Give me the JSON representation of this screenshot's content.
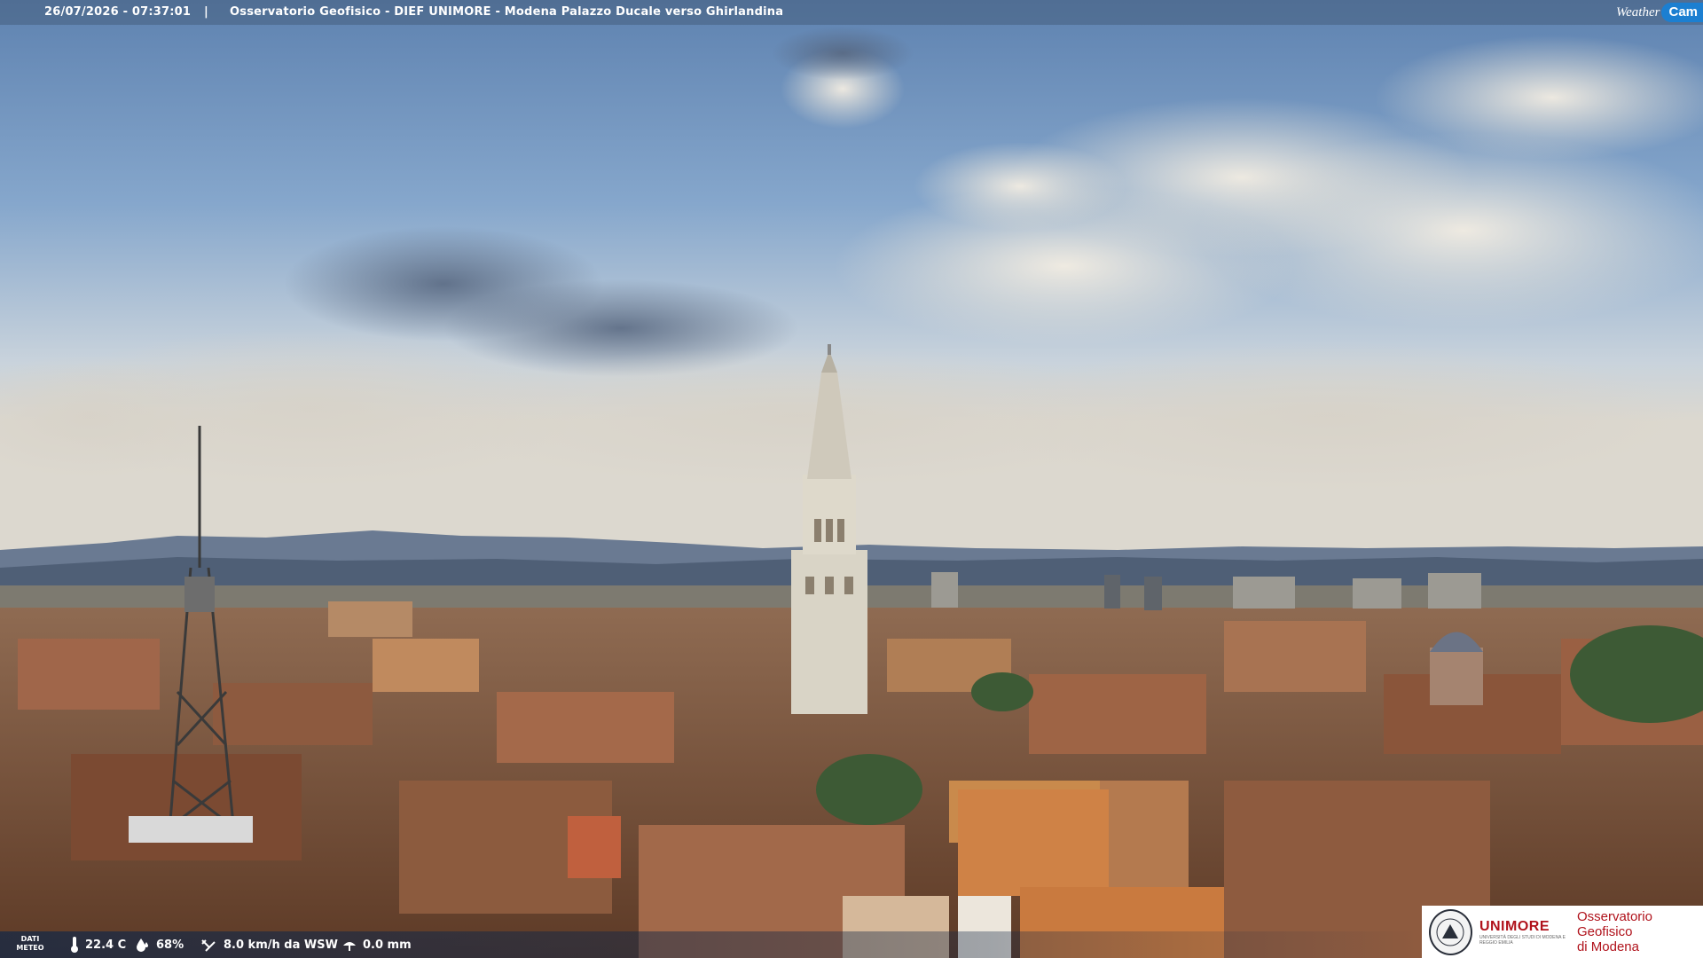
{
  "header": {
    "timestamp": "26/07/2026 - 07:37:01",
    "separator": "|",
    "title": "Osservatorio Geofisico - DIEF UNIMORE - Modena Palazzo Ducale verso Ghirlandina"
  },
  "brand": {
    "logo_word": "Weather",
    "logo_badge": "Cam",
    "logo_badge_color": "#1c7fd1"
  },
  "weather": {
    "label_line1": "DATI",
    "label_line2": "METEO",
    "temperature": "22.4 C",
    "humidity": "68%",
    "wind": "8.0 km/h da WSW",
    "rain": "0.0 mm",
    "icons": [
      "thermometer-icon",
      "humidity-drop-icon",
      "wind-icon",
      "rain-gauge-icon"
    ]
  },
  "badge": {
    "university": "UNIMORE",
    "university_sub": "UNIVERSITÀ DEGLI STUDI DI MODENA E REGGIO EMILIA",
    "observatory_line1": "Osservatorio Geofisico",
    "observatory_line2": "di Modena",
    "accent_color": "#b0121b"
  }
}
